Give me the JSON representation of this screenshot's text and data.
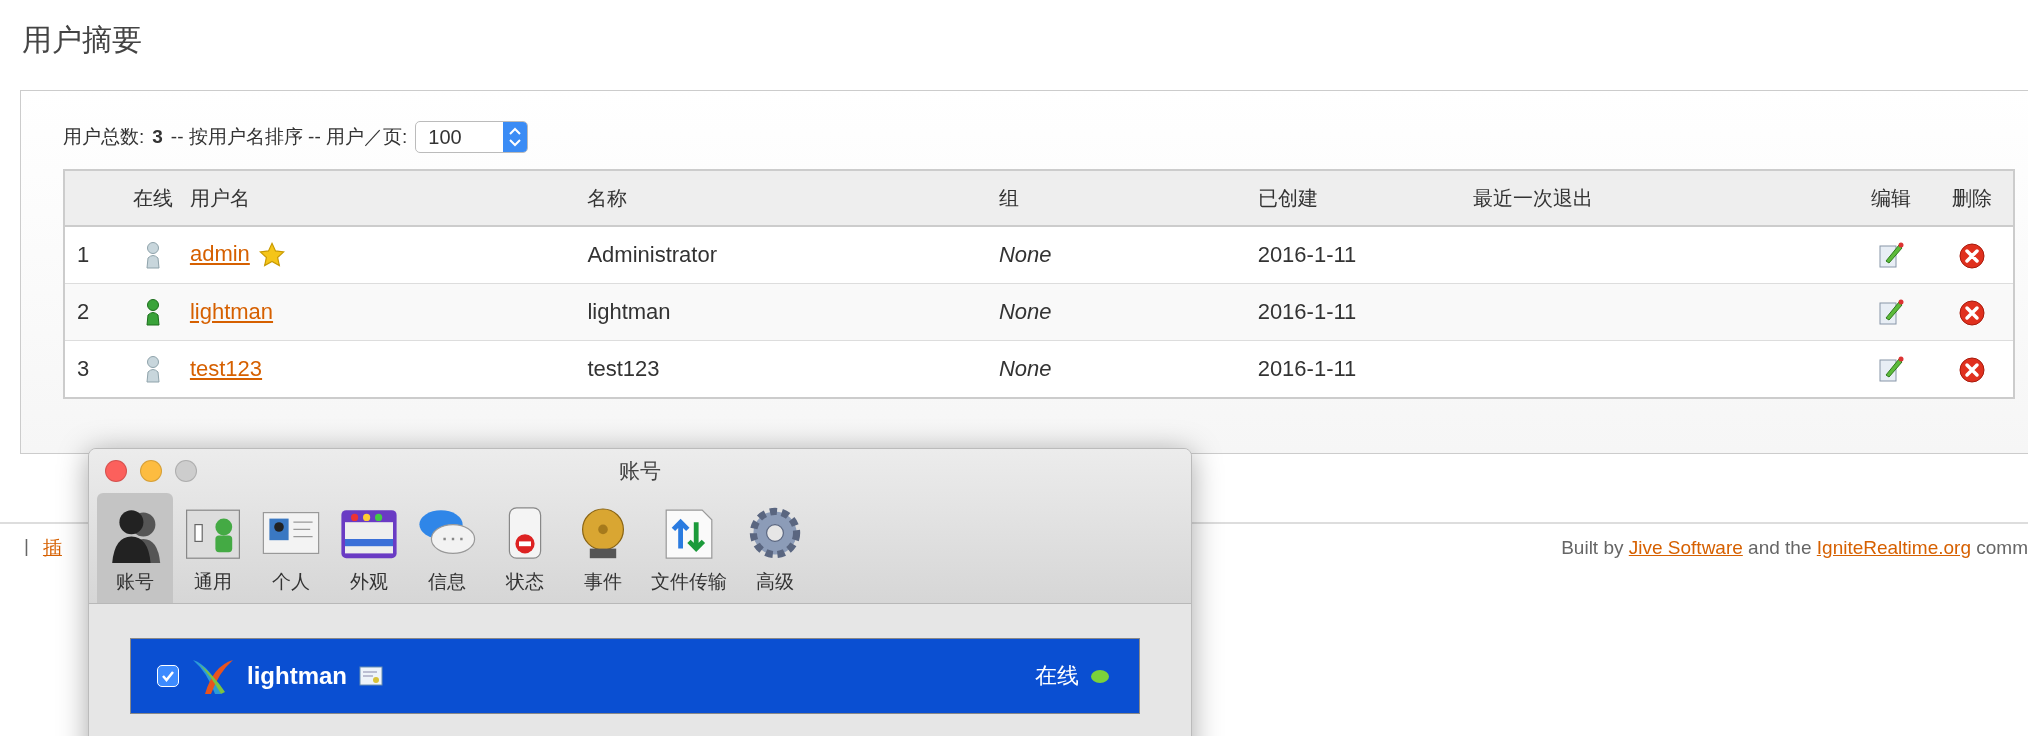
{
  "page_title": "用户摘要",
  "summary": {
    "total_label": "用户总数:",
    "total": "3",
    "sort_text": "-- 按用户名排序 -- 用户／页:",
    "per_page": "100"
  },
  "table": {
    "columns": [
      "在线",
      "用户名",
      "名称",
      "组",
      "已创建",
      "最近一次退出",
      "编辑",
      "删除"
    ],
    "rows": [
      {
        "index": "1",
        "online": false,
        "username": "admin",
        "admin": true,
        "name": "Administrator",
        "group": "None",
        "created": "2016-1-11"
      },
      {
        "index": "2",
        "online": true,
        "username": "lightman",
        "admin": false,
        "name": "lightman",
        "group": "None",
        "created": "2016-1-11"
      },
      {
        "index": "3",
        "online": false,
        "username": "test123",
        "admin": false,
        "name": "test123",
        "group": "None",
        "created": "2016-1-11"
      }
    ]
  },
  "footer": {
    "left_links": [
      "插"
    ],
    "separator": "|",
    "prefix": "Built by",
    "link_1": "Jive Software",
    "middle": "and the",
    "link_2": "IgniteRealtime.org",
    "suffix": "comm"
  },
  "prefs_window": {
    "title": "账号",
    "toolbar": [
      {
        "label": "账号",
        "selected": true
      },
      {
        "label": "通用",
        "selected": false
      },
      {
        "label": "个人",
        "selected": false
      },
      {
        "label": "外观",
        "selected": false
      },
      {
        "label": "信息",
        "selected": false
      },
      {
        "label": "状态",
        "selected": false
      },
      {
        "label": "事件",
        "selected": false
      },
      {
        "label": "文件传输",
        "selected": false
      },
      {
        "label": "高级",
        "selected": false
      }
    ],
    "account": {
      "checked": true,
      "name": "lightman",
      "status": "在线",
      "online": true
    }
  }
}
